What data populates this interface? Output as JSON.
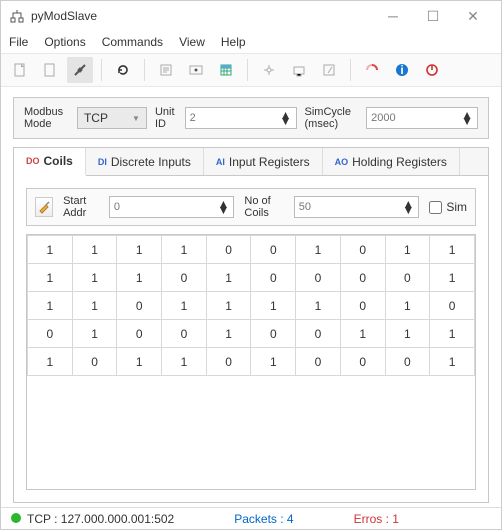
{
  "title": "pyModSlave",
  "menu": {
    "file": "File",
    "options": "Options",
    "commands": "Commands",
    "view": "View",
    "help": "Help"
  },
  "cfg": {
    "modeLabel": "Modbus Mode",
    "mode": "TCP",
    "unitIdLabel": "Unit ID",
    "unitId": "2",
    "simCycleLabel": "SimCycle (msec)",
    "simCycle": "2000"
  },
  "tabs": {
    "coils": "Coils",
    "di": "Discrete Inputs",
    "ir": "Input Registers",
    "hr": "Holding Registers",
    "pre": {
      "coils": "DO",
      "di": "DI",
      "ir": "AI",
      "hr": "AO"
    }
  },
  "coil": {
    "startAddrLabel": "Start Addr",
    "startAddr": "0",
    "countLabel": "No of Coils",
    "count": "50",
    "simLabel": "Sim"
  },
  "grid": [
    [
      "1",
      "1",
      "1",
      "1",
      "0",
      "0",
      "1",
      "0",
      "1",
      "1"
    ],
    [
      "1",
      "1",
      "1",
      "0",
      "1",
      "0",
      "0",
      "0",
      "0",
      "1"
    ],
    [
      "1",
      "1",
      "0",
      "1",
      "1",
      "1",
      "1",
      "0",
      "1",
      "0"
    ],
    [
      "0",
      "1",
      "0",
      "0",
      "1",
      "0",
      "0",
      "1",
      "1",
      "1"
    ],
    [
      "1",
      "0",
      "1",
      "1",
      "0",
      "1",
      "0",
      "0",
      "0",
      "1"
    ]
  ],
  "status": {
    "conn": "TCP : 127.000.000.001:502",
    "packets": "Packets : 4",
    "errors": "Erros : 1"
  }
}
